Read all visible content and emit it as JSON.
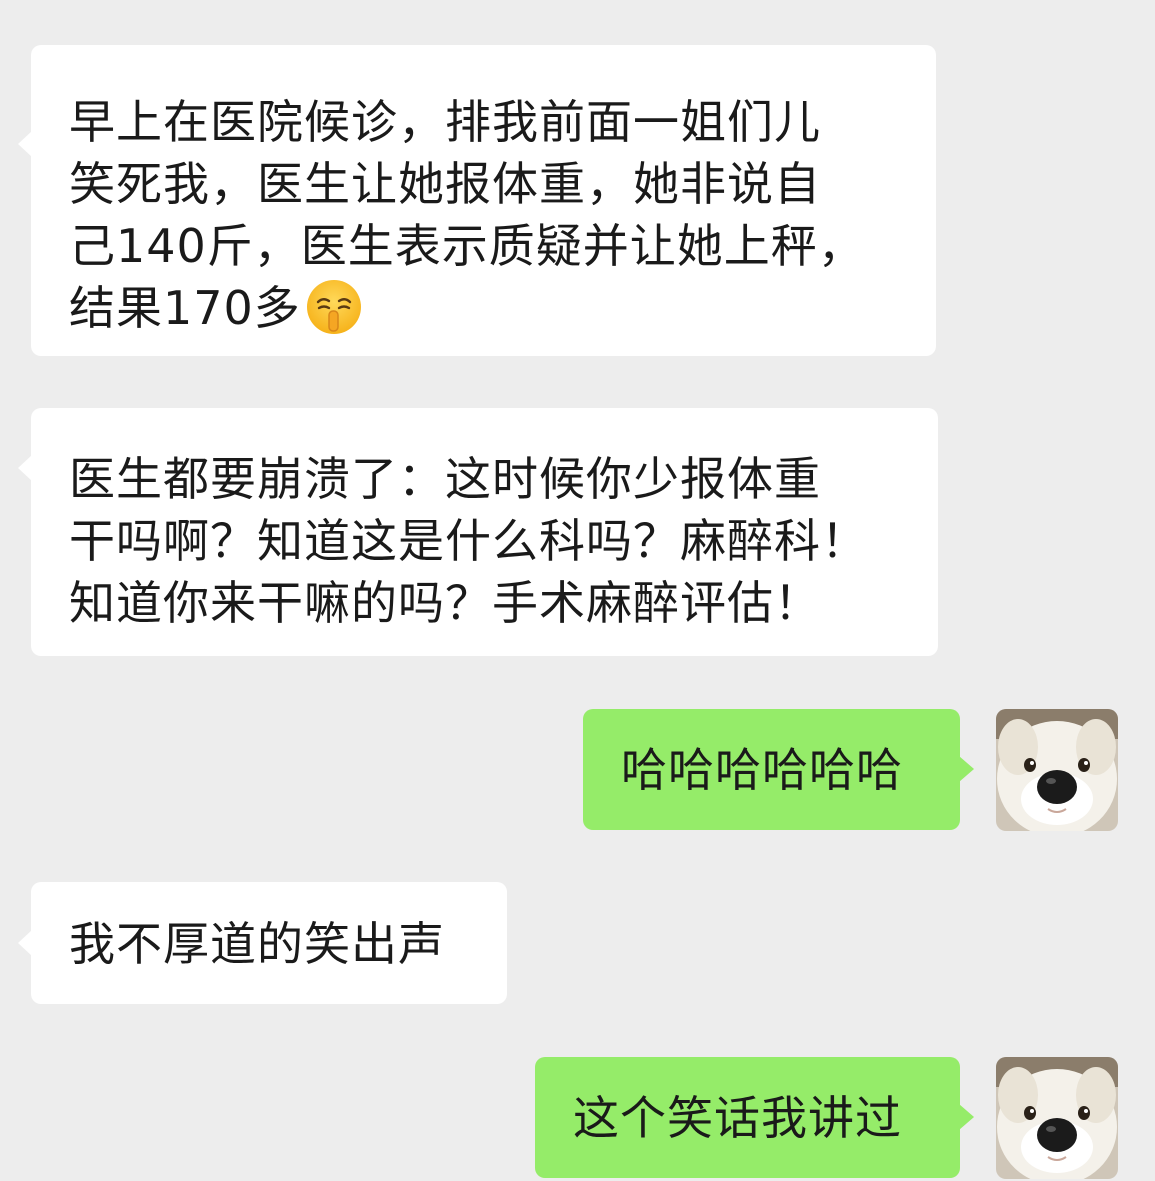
{
  "chat": {
    "messages": [
      {
        "side": "incoming",
        "lines": [
          "早上在医院候诊，排我前面一姐们儿",
          "笑死我，医生让她报体重，她非说自",
          "己140斤，医生表示质疑并让她上秤，",
          "结果170多"
        ],
        "emoji": "shushing-face-emoji"
      },
      {
        "side": "incoming",
        "lines": [
          "医生都要崩溃了：这时候你少报体重",
          "干吗啊？知道这是什么科吗？麻醉科！",
          "知道你来干嘛的吗？手术麻醉评估！"
        ]
      },
      {
        "side": "outgoing",
        "lines": [
          "哈哈哈哈哈哈"
        ],
        "avatar": "white-dog-avatar"
      },
      {
        "side": "incoming",
        "lines": [
          "我不厚道的笑出声"
        ]
      },
      {
        "side": "outgoing",
        "lines": [
          "这个笑话我讲过"
        ],
        "avatar": "white-dog-avatar"
      }
    ]
  },
  "colors": {
    "background": "#ededed",
    "incoming_bubble": "#ffffff",
    "outgoing_bubble": "#95ec69",
    "text": "#1a1a1a"
  }
}
